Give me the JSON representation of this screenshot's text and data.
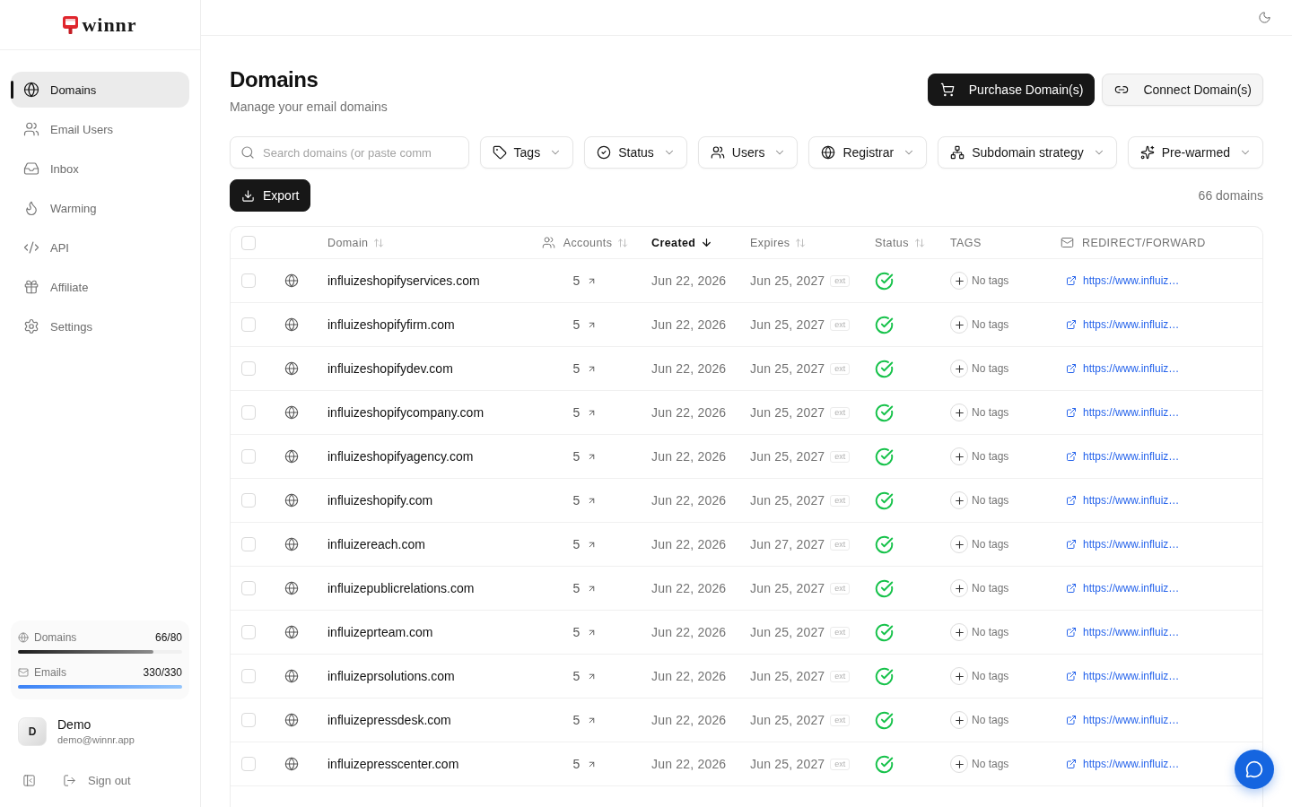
{
  "sidebar": {
    "logo": {
      "text": "winnr"
    },
    "nav": [
      {
        "label": "Domains",
        "selected": true
      },
      {
        "label": "Email Users",
        "selected": false
      },
      {
        "label": "Inbox",
        "selected": false
      },
      {
        "label": "Warming",
        "selected": false
      },
      {
        "label": "API",
        "selected": false
      },
      {
        "label": "Affiliate",
        "selected": false
      },
      {
        "label": "Settings",
        "selected": false
      }
    ],
    "usage": [
      {
        "kind": "domains",
        "label": "Domains",
        "value": "66/80",
        "level": 0.825
      },
      {
        "kind": "emails",
        "label": "Emails",
        "value": "330/330",
        "level": 1
      }
    ],
    "user": {
      "initial": "D",
      "name": "Demo",
      "email": "demo@winnr.app"
    },
    "sign_out": "Sign out"
  },
  "header": {
    "title": "Domains",
    "subtitle": "Manage your email domains",
    "actions": [
      {
        "kind": "primary",
        "label": "Purchase Domain(s)"
      },
      {
        "kind": "secondary",
        "label": "Connect Domain(s)"
      }
    ]
  },
  "filters": {
    "search": {
      "placeholder": "Search domains (or paste comm"
    },
    "dropdowns": [
      {
        "label": "Tags"
      },
      {
        "label": "Status"
      },
      {
        "label": "Users"
      },
      {
        "label": "Registrar"
      },
      {
        "label": "Subdomain strategy"
      },
      {
        "label": "Pre-warmed"
      }
    ]
  },
  "export": {
    "label": "Export"
  },
  "count": "66 domains",
  "table": {
    "select_all": {
      "checked": false
    },
    "columns": [
      {
        "label": "Domain",
        "sorted": false
      },
      {
        "label": "Accounts",
        "sorted": false
      },
      {
        "label": "Created",
        "sorted": true
      },
      {
        "label": "Expires",
        "sorted": false
      },
      {
        "label": "Status",
        "sorted": false
      },
      {
        "label": "TAGS"
      },
      {
        "label": "REDIRECT/FORWARD"
      }
    ],
    "rows": [
      {
        "checked": false,
        "domain": "influizeshopifyservices.com",
        "accounts": "5",
        "created": "Jun 22, 2026",
        "expires": "Jun 25, 2027",
        "expires_badge": "ext",
        "active": true,
        "tags": "No tags",
        "redirect": "https://www.influiz…"
      },
      {
        "checked": false,
        "domain": "influizeshopifyfirm.com",
        "accounts": "5",
        "created": "Jun 22, 2026",
        "expires": "Jun 25, 2027",
        "expires_badge": "ext",
        "active": true,
        "tags": "No tags",
        "redirect": "https://www.influiz…"
      },
      {
        "checked": false,
        "domain": "influizeshopifydev.com",
        "accounts": "5",
        "created": "Jun 22, 2026",
        "expires": "Jun 25, 2027",
        "expires_badge": "ext",
        "active": true,
        "tags": "No tags",
        "redirect": "https://www.influiz…"
      },
      {
        "checked": false,
        "domain": "influizeshopifycompany.com",
        "accounts": "5",
        "created": "Jun 22, 2026",
        "expires": "Jun 25, 2027",
        "expires_badge": "ext",
        "active": true,
        "tags": "No tags",
        "redirect": "https://www.influiz…"
      },
      {
        "checked": false,
        "domain": "influizeshopifyagency.com",
        "accounts": "5",
        "created": "Jun 22, 2026",
        "expires": "Jun 25, 2027",
        "expires_badge": "ext",
        "active": true,
        "tags": "No tags",
        "redirect": "https://www.influiz…"
      },
      {
        "checked": false,
        "domain": "influizeshopify.com",
        "accounts": "5",
        "created": "Jun 22, 2026",
        "expires": "Jun 25, 2027",
        "expires_badge": "ext",
        "active": true,
        "tags": "No tags",
        "redirect": "https://www.influiz…"
      },
      {
        "checked": false,
        "domain": "influizereach.com",
        "accounts": "5",
        "created": "Jun 22, 2026",
        "expires": "Jun 27, 2027",
        "expires_badge": "ext",
        "active": true,
        "tags": "No tags",
        "redirect": "https://www.influiz…"
      },
      {
        "checked": false,
        "domain": "influizepublicrelations.com",
        "accounts": "5",
        "created": "Jun 22, 2026",
        "expires": "Jun 25, 2027",
        "expires_badge": "ext",
        "active": true,
        "tags": "No tags",
        "redirect": "https://www.influiz…"
      },
      {
        "checked": false,
        "domain": "influizeprteam.com",
        "accounts": "5",
        "created": "Jun 22, 2026",
        "expires": "Jun 25, 2027",
        "expires_badge": "ext",
        "active": true,
        "tags": "No tags",
        "redirect": "https://www.influiz…"
      },
      {
        "checked": false,
        "domain": "influizeprsolutions.com",
        "accounts": "5",
        "created": "Jun 22, 2026",
        "expires": "Jun 25, 2027",
        "expires_badge": "ext",
        "active": true,
        "tags": "No tags",
        "redirect": "https://www.influiz…"
      },
      {
        "checked": false,
        "domain": "influizepressdesk.com",
        "accounts": "5",
        "created": "Jun 22, 2026",
        "expires": "Jun 25, 2027",
        "expires_badge": "ext",
        "active": true,
        "tags": "No tags",
        "redirect": "https://www.influiz…"
      },
      {
        "checked": false,
        "domain": "influizepresscenter.com",
        "accounts": "5",
        "created": "Jun 22, 2026",
        "expires": "Jun 25, 2027",
        "expires_badge": "ext",
        "active": true,
        "tags": "No tags",
        "redirect": "https://www.influiz…"
      }
    ]
  }
}
